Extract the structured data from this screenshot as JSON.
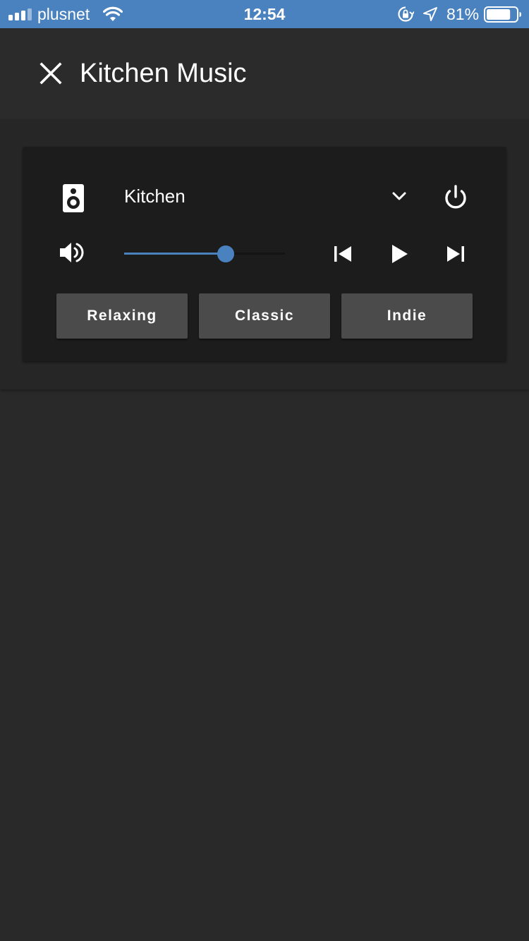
{
  "status_bar": {
    "carrier": "plusnet",
    "time": "12:54",
    "battery_percent": "81%",
    "battery_level": 0.81
  },
  "header": {
    "title": "Kitchen Music",
    "close_icon": "close-icon"
  },
  "player": {
    "entity_name": "Kitchen",
    "volume_level": 0.63,
    "icons": {
      "speaker": "speaker-icon",
      "dropdown": "chevron-down-icon",
      "power": "power-icon",
      "volume": "volume-high-icon",
      "previous": "skip-previous-icon",
      "play": "play-icon",
      "next": "skip-next-icon"
    },
    "presets": [
      "Relaxing",
      "Classic",
      "Indie"
    ]
  },
  "colors": {
    "accent": "#4a82bf",
    "status_bar": "#4a82bf",
    "background": "#292929",
    "card": "#1c1c1c",
    "button": "#4b4b4b"
  }
}
